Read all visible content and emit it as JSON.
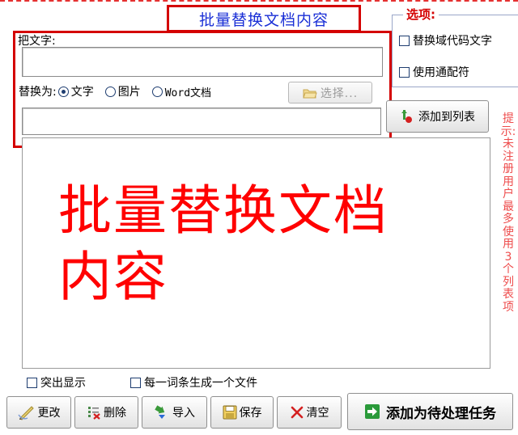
{
  "title": "批量替换文档内容",
  "options": {
    "legend": "选项:",
    "replace_field_code": "替换域代码文字",
    "use_wildcard": "使用通配符"
  },
  "find": {
    "label": "把文字:",
    "value": ""
  },
  "replace": {
    "label": "替换为:",
    "options": [
      "文字",
      "图片",
      "Word文档"
    ],
    "selected": "文字",
    "value": "",
    "select_button": "选择..."
  },
  "add_to_list_button": "添加到列表",
  "list": {
    "watermark_line1": "批量替换文档",
    "watermark_line2": "内容"
  },
  "hint": "提示:未注册用户最多使用3个列表项",
  "checkboxes": {
    "highlight": "突出显示",
    "per_file": "每一词条生成一个文件"
  },
  "toolbar": {
    "edit": "更改",
    "delete": "删除",
    "import": "导入",
    "save": "保存",
    "clear": "清空",
    "add_task": "添加为待处理任务"
  },
  "colors": {
    "accent_red": "#d40000",
    "title_blue": "#1a2fd6",
    "hint_red": "#ee4b4b"
  }
}
